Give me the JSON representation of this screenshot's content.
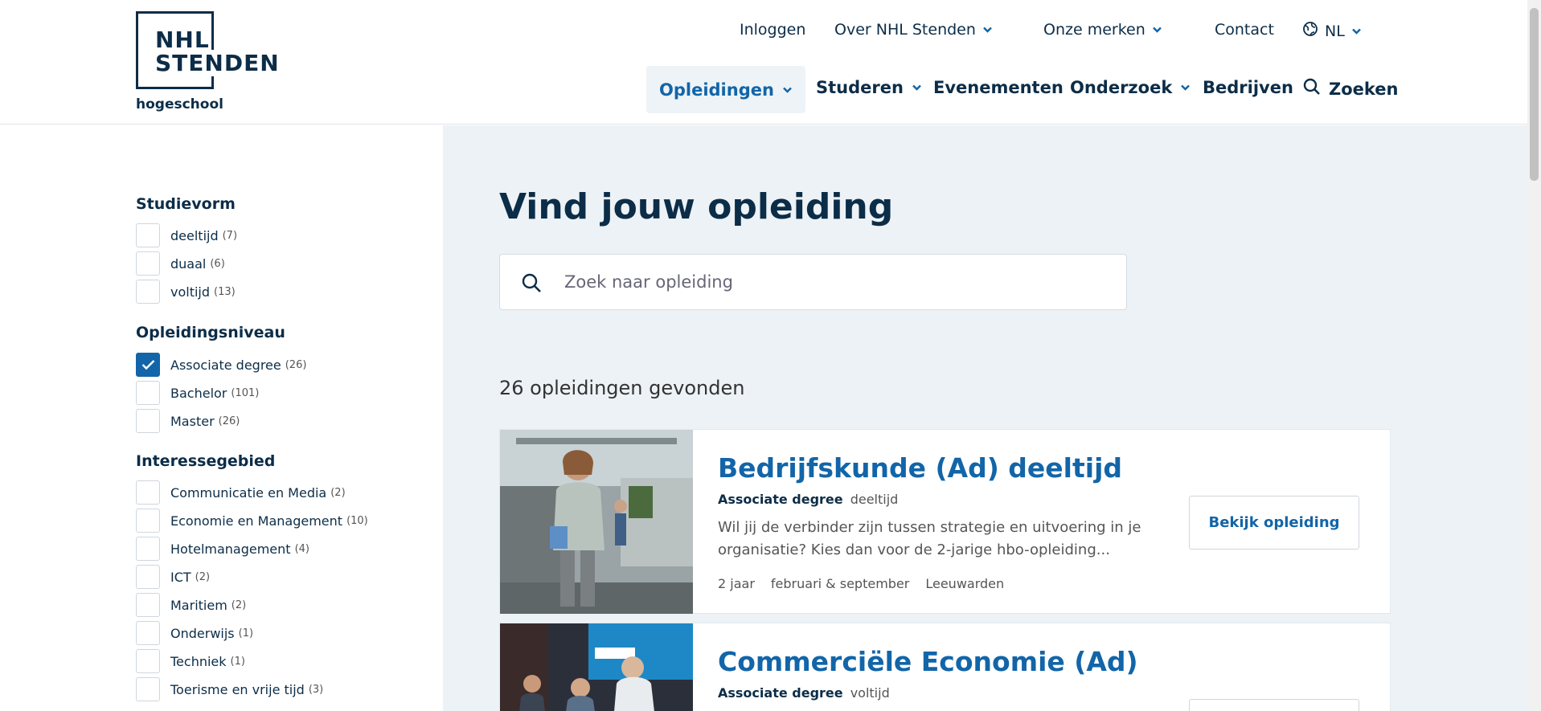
{
  "logo": {
    "line1": "NHL",
    "line2": "STENDEN",
    "subtitle": "hogeschool"
  },
  "top_nav": [
    {
      "label": "Inloggen"
    },
    {
      "label": "Over NHL Stenden"
    },
    {
      "label": "Onze merken"
    },
    {
      "label": "Contact"
    },
    {
      "label": "NL"
    }
  ],
  "main_nav": [
    {
      "label": "Opleidingen"
    },
    {
      "label": "Studeren"
    },
    {
      "label": "Evenementen"
    },
    {
      "label": "Onderzoek"
    },
    {
      "label": "Bedrijven"
    },
    {
      "label": "Zoeken"
    }
  ],
  "filters": {
    "studievorm": {
      "title": "Studievorm",
      "items": [
        {
          "label": "deeltijd",
          "count": "(7)",
          "checked": false
        },
        {
          "label": "duaal",
          "count": "(6)",
          "checked": false
        },
        {
          "label": "voltijd",
          "count": "(13)",
          "checked": false
        }
      ]
    },
    "niveau": {
      "title": "Opleidingsniveau",
      "items": [
        {
          "label": "Associate degree",
          "count": "(26)",
          "checked": true
        },
        {
          "label": "Bachelor",
          "count": "(101)",
          "checked": false
        },
        {
          "label": "Master",
          "count": "(26)",
          "checked": false
        }
      ]
    },
    "interesse": {
      "title": "Interessegebied",
      "items": [
        {
          "label": "Communicatie en Media",
          "count": "(2)",
          "checked": false
        },
        {
          "label": "Economie en Management",
          "count": "(10)",
          "checked": false
        },
        {
          "label": "Hotelmanagement",
          "count": "(4)",
          "checked": false
        },
        {
          "label": "ICT",
          "count": "(2)",
          "checked": false
        },
        {
          "label": "Maritiem",
          "count": "(2)",
          "checked": false
        },
        {
          "label": "Onderwijs",
          "count": "(1)",
          "checked": false
        },
        {
          "label": "Techniek",
          "count": "(1)",
          "checked": false
        },
        {
          "label": "Toerisme en vrije tijd",
          "count": "(3)",
          "checked": false
        }
      ]
    }
  },
  "main": {
    "title": "Vind jouw opleiding",
    "search_placeholder": "Zoek naar opleiding",
    "results_count": "26 opleidingen gevonden"
  },
  "results": [
    {
      "title": "Bedrijfskunde (Ad) deeltijd",
      "level": "Associate degree",
      "mode": "deeltijd",
      "description": "Wil jij de verbinder zijn tussen strategie en uitvoering in je organisatie? Kies dan voor de 2-jarige hbo-opleiding...",
      "duration": "2 jaar",
      "start": "februari & september",
      "location": "Leeuwarden",
      "button": "Bekijk opleiding"
    },
    {
      "title": "Commerciële Economie (Ad)",
      "level": "Associate degree",
      "mode": "voltijd"
    }
  ],
  "colors": {
    "navy": "#0c2d48",
    "blue": "#1265a8",
    "panel": "#edf2f6"
  }
}
